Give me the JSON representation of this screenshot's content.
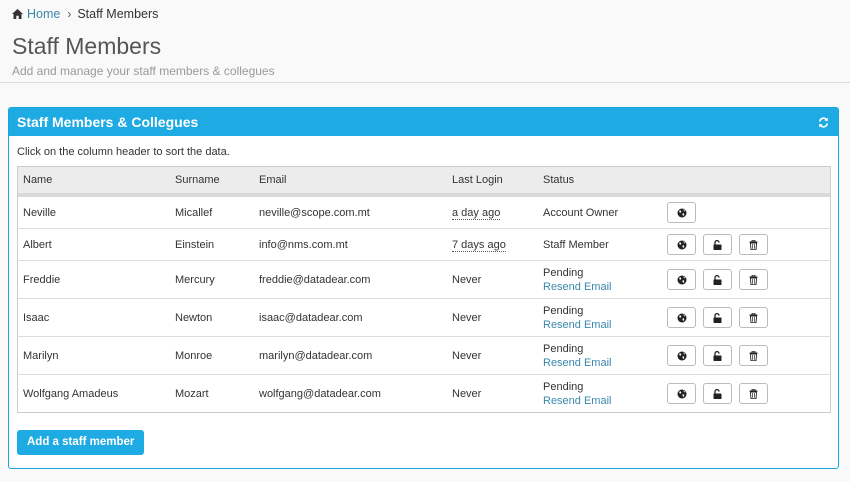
{
  "breadcrumb": {
    "home": "Home",
    "separator": "›",
    "current": "Staff Members"
  },
  "header": {
    "title": "Staff Members",
    "subtitle": "Add and manage your staff members & collegues"
  },
  "panel": {
    "title": "Staff Members & Collegues",
    "hint": "Click on the column header to sort the data.",
    "columns": {
      "name": "Name",
      "surname": "Surname",
      "email": "Email",
      "last_login": "Last Login",
      "status": "Status"
    },
    "rows": [
      {
        "name": "Neville",
        "surname": "Micallef",
        "email": "neville@scope.com.mt",
        "last_login": "a day ago",
        "status": "Account Owner",
        "resend": ""
      },
      {
        "name": "Albert",
        "surname": "Einstein",
        "email": "info@nms.com.mt",
        "last_login": "7 days ago",
        "status": "Staff Member",
        "resend": ""
      },
      {
        "name": "Freddie",
        "surname": "Mercury",
        "email": "freddie@datadear.com",
        "last_login": "Never",
        "status": "Pending",
        "resend": "Resend Email"
      },
      {
        "name": "Isaac",
        "surname": "Newton",
        "email": "isaac@datadear.com",
        "last_login": "Never",
        "status": "Pending",
        "resend": "Resend Email"
      },
      {
        "name": "Marilyn",
        "surname": "Monroe",
        "email": "marilyn@datadear.com",
        "last_login": "Never",
        "status": "Pending",
        "resend": "Resend Email"
      },
      {
        "name": "Wolfgang Amadeus",
        "surname": "Mozart",
        "email": "wolfgang@datadear.com",
        "last_login": "Never",
        "status": "Pending",
        "resend": "Resend Email"
      }
    ],
    "add_button": "Add a staff member"
  },
  "icons": {
    "home": "home-icon",
    "refresh": "refresh-icon",
    "globe": "globe-icon",
    "unlock": "unlock-icon",
    "trash": "trash-icon"
  },
  "colors": {
    "accent": "#1eaae2",
    "link": "#3a87ad"
  }
}
